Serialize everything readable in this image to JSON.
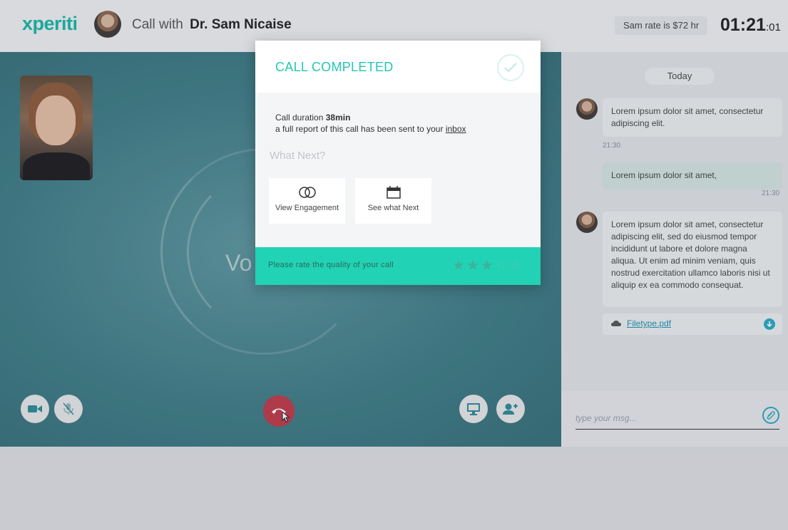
{
  "header": {
    "logo": "xperiti",
    "call_with_prefix": "Call with",
    "callee_name": "Dr. Sam Nicaise",
    "rate": "Sam rate is $72 hr",
    "timer_main": "01:21",
    "timer_seconds": ":01"
  },
  "video": {
    "background_text": "Vo",
    "controls": {
      "camera": "camera-icon",
      "mic": "mic-muted-icon",
      "end_call": "phone-hangup-icon",
      "screen_share": "monitor-icon",
      "add_user": "add-user-icon"
    }
  },
  "modal": {
    "title": "CALL COMPLETED",
    "duration_label": "Call duration",
    "duration_value": "38min",
    "report_text": "a full report of this call has been sent to your",
    "report_link": "inbox",
    "what_next": "What Next?",
    "cards": [
      {
        "label": "View Engagement",
        "icon": "engagement-icon"
      },
      {
        "label": "See what Next",
        "icon": "calendar-icon"
      }
    ],
    "rating_prompt": "Please rate the quality of your call",
    "rating": {
      "value": 3,
      "max": 5
    }
  },
  "chat": {
    "day_label": "Today",
    "messages": [
      {
        "text": "Lorem ipsum dolor sit amet, consectetur adipiscing elit.",
        "time": "21:30",
        "from": "other"
      },
      {
        "text": "Lorem ipsum dolor sit amet,",
        "time": "21:30",
        "from": "me"
      },
      {
        "text": "Lorem ipsum dolor sit amet, consectetur adipiscing elit, sed do eiusmod tempor incididunt ut labore et dolore magna aliqua. Ut enim ad minim veniam, quis nostrud exercitation ullamco laboris nisi ut aliquip ex ea commodo consequat.",
        "from": "other"
      }
    ],
    "attachment": "Filetype.pdf",
    "input_placeholder": "type your msg..."
  },
  "colors": {
    "brand": "#17b7a8",
    "modal_accent": "#21d2b4",
    "end_call": "#c0394b",
    "video_bg": "#3f7d88"
  }
}
